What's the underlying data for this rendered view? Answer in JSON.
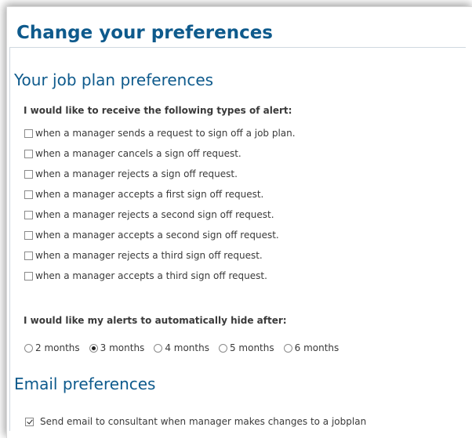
{
  "page": {
    "title": "Change your preferences"
  },
  "job_plan": {
    "heading": "Your job plan preferences",
    "alert_prompt": "I would like to receive the following types of alert:",
    "alerts": [
      {
        "label": "when a manager sends a request to sign off a job plan.",
        "checked": false
      },
      {
        "label": "when a manager cancels a sign off request.",
        "checked": false
      },
      {
        "label": "when a manager rejects a sign off request.",
        "checked": false
      },
      {
        "label": "when a manager accepts a first sign off request.",
        "checked": false
      },
      {
        "label": "when a manager rejects a second sign off request.",
        "checked": false
      },
      {
        "label": "when a manager accepts a second sign off request.",
        "checked": false
      },
      {
        "label": "when a manager rejects a third sign off request.",
        "checked": false
      },
      {
        "label": "when a manager accepts a third sign off request.",
        "checked": false
      }
    ],
    "hide_prompt": "I would like my alerts to automatically hide after:",
    "hide_options": [
      {
        "label": "2 months",
        "selected": false
      },
      {
        "label": "3 months",
        "selected": true
      },
      {
        "label": "4 months",
        "selected": false
      },
      {
        "label": "5 months",
        "selected": false
      },
      {
        "label": "6 months",
        "selected": false
      }
    ]
  },
  "email": {
    "heading": "Email preferences",
    "send_email_label": "Send email to consultant when manager makes changes to a jobplan",
    "send_email_checked": true
  },
  "colors": {
    "heading": "#0e5a8c",
    "text": "#3a3a3a"
  }
}
